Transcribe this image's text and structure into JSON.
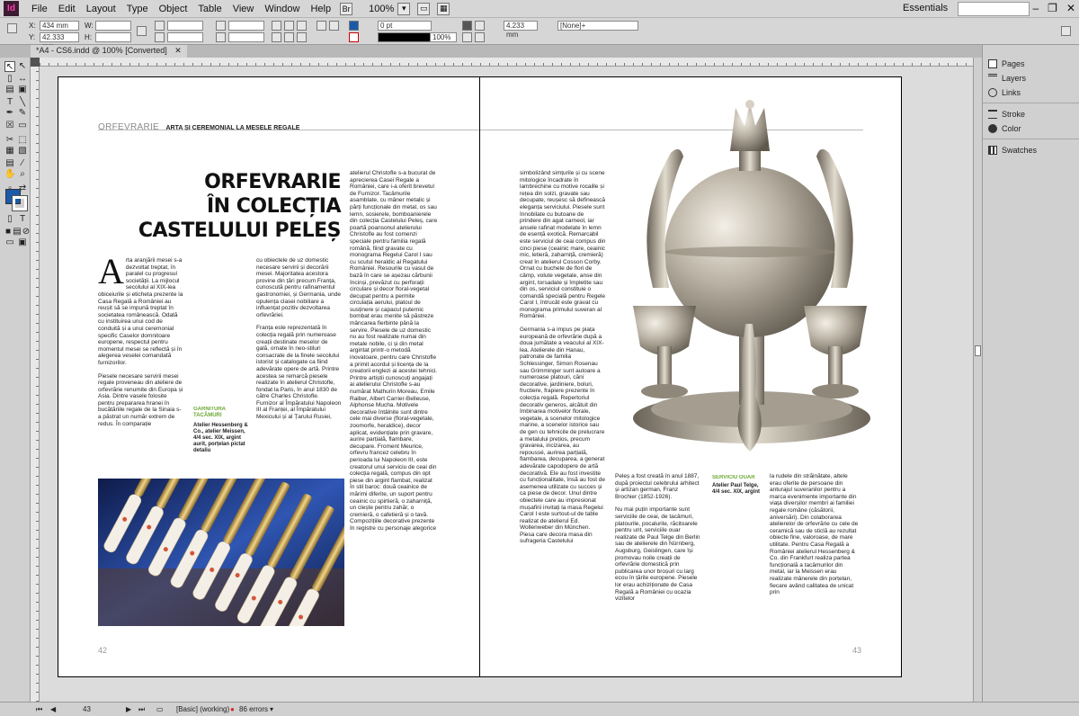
{
  "app": {
    "logo": "Id",
    "menu": [
      "File",
      "Edit",
      "Layout",
      "Type",
      "Object",
      "Table",
      "View",
      "Window",
      "Help"
    ],
    "zoom": "100%",
    "workspace": "Essentials"
  },
  "control": {
    "x_label": "X:",
    "x_value": "434 mm",
    "y_label": "Y:",
    "y_value": "42.333 mm",
    "w_label": "W:",
    "h_label": "H:",
    "stroke_weight": "0 pt",
    "opacity": "100%",
    "size_value": "4.233 mm",
    "object_style": "[None]+"
  },
  "document": {
    "tab_title": "*A4 - CS6.indd @ 100% [Converted]"
  },
  "left_page": {
    "running_head_section": "ORFEVRARIE",
    "running_head_title": "ARTA ȘI CEREMONIAL LA MESELE REGALE",
    "headline_1": "ORFEVRARIE",
    "headline_2": "ÎN COLECȚIA",
    "headline_3": "CASTELULUI PELEȘ",
    "drop_cap": "A",
    "col1_lead": "rta aranjării mesei s-a dezvoltat treptat, în paralel cu progresul societății. La mijlocul secolului al XIX-lea obiceiurile și eticheta prezente la Casa Regală a României au reușit să se impună treptat în societatea românească. Odată cu instituirea unui cod de conduită și a unui ceremonial specific Caselor domnitoare europene, respectul pentru momentul mesei se reflectă și în alegerea veselei comandată furnizorilor.",
    "col1_p2": "Piesele necesare servirii mesei regale proveneau din ateliere de orfevrărie renumite din Europa și Asia. Dintre vasele folosite pentru prepararea hranei în bucătăriile regale de la Sinaia s-a păstrat un număr extrem de redus. În comparație",
    "col2_p1": "cu obiectele de uz domestic necesare servirii și decorării mesei. Majoritatea acestora provine din țări precum Franța, cunoscută pentru rafinamentul gastronomiei, și Germania, unde opulența clasei nobiliare a influențat pozitiv dezvoltarea orfevrăriei.",
    "col2_p2": "Franța este reprezentată în colecția regală prin numeroase creații destinate meselor de gală, ornate în neo-stiluri consacrate de la finele secolului istorist și catalogate ca fiind adevărate opere de artă. Printre acestea se remarcă piesele realizate în atelierul Christofle, fondat la Paris, în anul 1830 de către Charles Christofle. Furnizor al Împăratului Napoleon III al Franței, al Împăratului Mexicului și al Țarului Rusiei,",
    "caption_title": "GARNITURA TACÂMURI",
    "caption_body": "Atelier Hessenberg & Co., atelier Meissen, 4/4 sec. XIX, argint aurit, porțelan pictat detaliu",
    "col3_text": "atelierul Christofle s-a bucurat de aprecierea Casei Regale a României, care i-a oferit brevetul de Furnizor. Tacâmurile asamblate, cu mâner metalic și părți funcționale din metal, os sau lemn, sosierele, bomboanierele din colecția Castelului Peleș, care poartă poansonul atelierului Christofle au fost comenzi speciale pentru familia regală română, fiind gravate cu monograma Regelui Carol I sau cu scutul heraldic al Regatului României. Resourile cu vasul de bază în care se așezau cărbunii încinși, prevăzut cu perforații circulare și decor floral-vegetal decupat pentru a permite circulația aerului, platoul de susținere și capacul puternic bombat erau menite să păstreze mâncarea fierbinte până la servire. Piesele de uz domestic nu au fost realizate numai din metale nobile, ci și din metal argintat printr-o metodă inovatoare, pentru care Christofle a primit acordul și licența de la creatorii englezi ai acestei tehnici. Printre artiștii cunoscuți angajați ai atelierului Christofle s-au numărat Mathurin Moreau, Emile Raiber, Albert Carrier-Belleuse, Alphonse Mucha. Motivele decorative întâlnite sunt dintre cele mai diverse (floral-vegetale, zoomorfe, heraldice), decor aplicat, evidențiate prin gravare, aurire parțială, flambare, decupare. Froment Meurice, orfevru francez celebru în perioada lui Napoleon III, este creatorul unui serviciu de ceai din colecția regală, compus din opt piese din argint flambat, realizat în stil baroc: două ceainice de mărimi diferite, un suport pentru ceainic cu spirtieră, o zaharniță, un clește pentru zahăr, o cremieră, o cafetieră și o tavă. Compozițiile decorative prezente în registre cu personaje alegorice",
    "page_number": "42"
  },
  "right_page": {
    "col1_p1": "simbolizând simțurile și cu scene mitologice încadrate în lambrechine cu motive rocaille și rețea din solzi, gravate sau decupate, reușesc să definească eleganța serviciului. Piesele sunt înnobilate cu butoane de prindere din agat carneol, iar anselе rafinat modelate în lemn de esență exotică. Remarcabil este serviciul de ceai compus din cinci piese (ceainic mare, ceainic mic, letieră, zaharniță, cremieră) creat în atelierul Cosson Corby. Ornat cu buchete de flori de câmp, volute vegetale, anse din argint, torsadate și împletite sau din os, serviciul constituie o comandă specială pentru Regele Carol I, întrucât este gravat cu monograma primului suveran al României.",
    "col1_p2": "Germania s-a impus pe piața europeană de orfevrărie după a doua jumătate a veacului al XIX-lea. Atelierele din Hanau, patronate de familia Schlessinger, Simon Rosenau sau Grimminger sunt autoare a numeroase platouri, căni decorative, jardiniere, boluri, fructiere, frapiere prezente în colecția regală. Repertoriul decorativ generos, alcătuit din îmbinarea motivelor florale, vegetale, a scenelor mitologice marine, a scenelor istorice sau de gen cu tehnicile de prelucrare a metalului prețios, precum gravarea, incizarea, au repoussé, aurirea parțială, flambarea, decuparea, a generat adevărate capodopere de artă decorativă. Ele au fost investite cu funcționalitate, însă au fost de asemenea utilizate cu succes și ca piese de decor. Unul dintre obiectele care au impresionat mușafirii invitați la masa Regelui Carol I este surtout-ul de table realizat de atelierul Ed. Wollenweber din München. Piesa care decora masa din sufrageria Castelului",
    "col2_p1": "Peleș a fost creată în anul 1887, după proiectul celebrului arhitect și artizan german, Franz Brochier (1852-1926).",
    "col2_p2": "Nu mai puțin importante sunt serviciile de ceai, de tacâmuri, platourile, pocalurile, răcitoarele pentru unt, serviciile ouar realizate de Paul Telge din Berlin sau de atelierele din Nürnberg, Augsburg, Geislingen, care își promovau noile creații de orfevrărie domestică prin publicarea unor broșuri cu larg ecou în țările europene. Piesele lor erau achiziționate de Casa Regală a României cu ocazia vizitelor",
    "caption_title": "SERVICIU OUAR",
    "caption_body": "Atelier Paul Telge, 4/4 sec. XIX, argint",
    "col3_text": "la rudele din străinătate, altele erau oferite de persoane din anturajul suveranilor pentru a marca evenimente importante din viața diverșilor membri ai familiei regale române (căsătorii, aniversări). Din colaborarea atelierelor de orfevrărie cu cele de ceramică sau de sticlă au rezultat obiecte fine, valoroase, de mare utilitate. Pentru Casa Regală a României atelierul Hessenberg & Co. din Frankfurt realiza partea funcțională a tacâmurilor din metal, iar la Meissen erau realizate mânerele din porțelan, fiecare având calitatea de unicat prin",
    "page_number": "43"
  },
  "panels": [
    "Pages",
    "Layers",
    "Links",
    "Stroke",
    "Color",
    "Swatches"
  ],
  "status": {
    "page": "43",
    "style": "[Basic] (working)",
    "errors": "86 errors"
  },
  "colors": {
    "accent_green": "#6aa832",
    "ui_gray": "#d6d6d6",
    "pasteboard": "#dcdcdc",
    "fill_blue": "#1b5aa8"
  }
}
